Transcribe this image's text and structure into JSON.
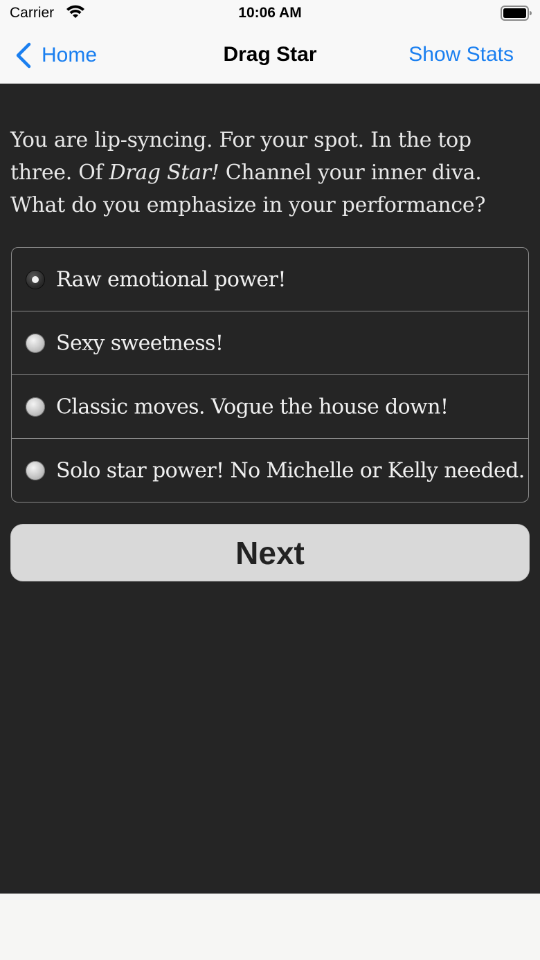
{
  "status_bar": {
    "carrier": "Carrier",
    "time": "10:06 AM",
    "wifi_icon": "wifi-icon",
    "battery_icon": "battery-icon"
  },
  "nav": {
    "back_label": "Home",
    "title": "Drag Star",
    "right_label": "Show Stats",
    "accent_color": "#1a7ff0"
  },
  "question": {
    "before": "You are lip-syncing. For your spot. In the top three. Of ",
    "emphasis": "Drag Star!",
    "after": " Channel your inner diva. What do you emphasize in your performance?"
  },
  "choices": [
    {
      "label": "Raw emotional power!",
      "selected": true
    },
    {
      "label": "Sexy sweetness!",
      "selected": false
    },
    {
      "label": "Classic moves. Vogue the house down!",
      "selected": false
    },
    {
      "label": "Solo star power! No Michelle or Kelly needed.",
      "selected": false
    }
  ],
  "next_button": {
    "label": "Next"
  },
  "colors": {
    "background": "#252525",
    "text": "#e8e8e8",
    "button": "#d9d9d9"
  }
}
